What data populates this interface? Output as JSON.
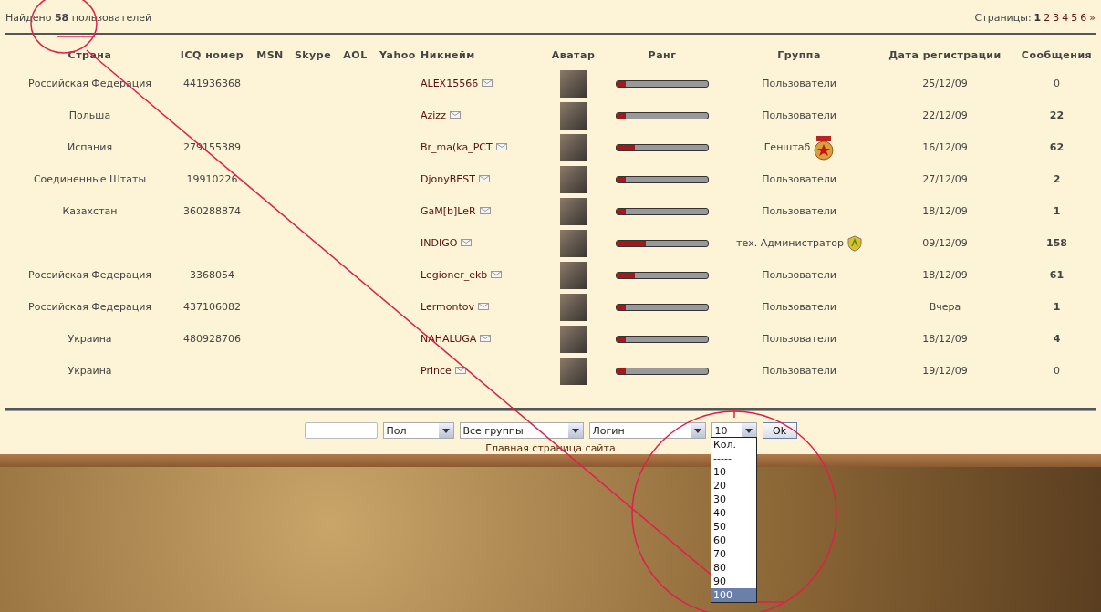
{
  "summary": {
    "prefix": "Найдено",
    "count": "58",
    "suffix": "пользователей"
  },
  "pagination": {
    "label": "Страницы:",
    "pages": [
      {
        "label": "1",
        "selected": true
      },
      {
        "label": "2",
        "selected": false
      },
      {
        "label": "3",
        "selected": false
      },
      {
        "label": "4",
        "selected": false
      },
      {
        "label": "5",
        "selected": false
      },
      {
        "label": "6",
        "selected": false
      },
      {
        "label": "»",
        "selected": false
      }
    ]
  },
  "table": {
    "columns": [
      "Страна",
      "ICQ номер",
      "MSN",
      "Skype",
      "AOL",
      "Yahoo",
      "Никнейм",
      "Аватар",
      "Ранг",
      "Группа",
      "Дата регистрации",
      "Сообщения"
    ],
    "rows": [
      {
        "kind": "plain",
        "country": "Российская Федерация",
        "icq": "441936368",
        "nickname": "ALEX15566",
        "level": 0.1,
        "group": "Пользователи",
        "registered": "25/12/09",
        "messages": "0",
        "messages_bold": false
      },
      {
        "kind": "plain",
        "country": "Польша",
        "nickname": "Azizz",
        "level": 0.1,
        "group": "Пользователи",
        "registered": "22/12/09",
        "messages": "22",
        "messages_bold": true
      },
      {
        "kind": "badge",
        "country": "Испания",
        "icq": "279155389",
        "nickname": "Br_ma(ka_PCT",
        "level": 0.2,
        "group": "Генштаб",
        "registered": "16/12/09",
        "messages": "62",
        "messages_bold": true
      },
      {
        "kind": "plain",
        "country": "Соединенные Штаты",
        "icq": "19910226",
        "nickname": "DjonyBEST",
        "level": 0.1,
        "group": "Пользователи",
        "registered": "27/12/09",
        "messages": "2",
        "messages_bold": true
      },
      {
        "kind": "plain",
        "country": "Казахстан",
        "icq": "360288874",
        "nickname": "GaM[b]LeR",
        "level": 0.1,
        "group": "Пользователи",
        "registered": "18/12/09",
        "messages": "1",
        "messages_bold": true
      },
      {
        "kind": "admin",
        "nickname": "INDIGO",
        "level": 0.32,
        "group": "тех. Администратор",
        "registered": "09/12/09",
        "messages": "158",
        "messages_bold": true
      },
      {
        "kind": "plain",
        "country": "Российская Федерация",
        "icq": "3368054",
        "nickname": "Legioner_ekb",
        "level": 0.2,
        "group": "Пользователи",
        "registered": "18/12/09",
        "messages": "61",
        "messages_bold": true
      },
      {
        "kind": "plain",
        "country": "Российская Федерация",
        "icq": "437106082",
        "nickname": "Lermontov",
        "level": 0.1,
        "group": "Пользователи",
        "registered": "Вчера",
        "messages": "1",
        "messages_bold": true
      },
      {
        "kind": "plain",
        "country": "Украина",
        "icq": "480928706",
        "nickname": "NAHALUGA",
        "level": 0.1,
        "group": "Пользователи",
        "registered": "18/12/09",
        "messages": "4",
        "messages_bold": true
      },
      {
        "kind": "plain",
        "country": "Украина",
        "nickname": "Prince",
        "level": 0.1,
        "group": "Пользователи",
        "registered": "19/12/09",
        "messages": "0",
        "messages_bold": false
      }
    ]
  },
  "filter": {
    "gender": "Пол",
    "group": "Все группы",
    "sort": "Логин",
    "count": "10",
    "count_options": [
      {
        "label": "Кол.",
        "selected": false
      },
      {
        "label": "-----",
        "selected": false
      },
      {
        "label": "10",
        "selected": false
      },
      {
        "label": "20",
        "selected": false
      },
      {
        "label": "30",
        "selected": false
      },
      {
        "label": "40",
        "selected": false
      },
      {
        "label": "50",
        "selected": false
      },
      {
        "label": "60",
        "selected": false
      },
      {
        "label": "70",
        "selected": false
      },
      {
        "label": "80",
        "selected": false
      },
      {
        "label": "90",
        "selected": false
      },
      {
        "label": "100",
        "selected": true
      }
    ],
    "submit": "Ok"
  },
  "home_link": "Главная страница сайта"
}
